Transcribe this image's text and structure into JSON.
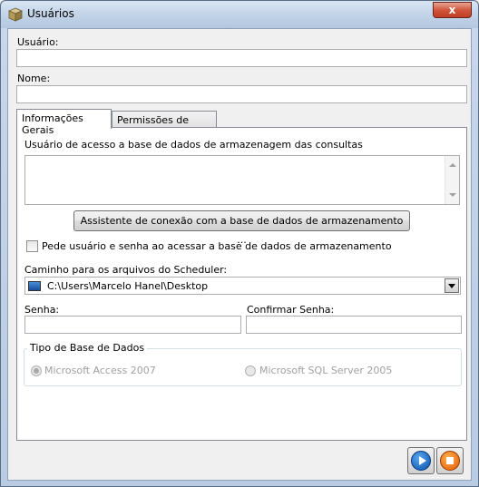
{
  "window": {
    "title": "Usuários",
    "close_label": "x"
  },
  "form": {
    "usuario_label": "Usuário:",
    "usuario_value": "",
    "nome_label": "Nome:",
    "nome_value": ""
  },
  "tabs": [
    {
      "label": "Informações Gerais",
      "active": true
    },
    {
      "label": "Permissões de Acesso",
      "active": false
    }
  ],
  "general": {
    "db_user_label": "Usuário de acesso a base de dados de armazenagem das consultas",
    "db_user_value": "",
    "wizard_button": "Assistente de conexão com a base de dados de armazenamento ...",
    "ask_credentials_label": "Pede usuário e senha ao acessar a base de dados de armazenamento",
    "ask_credentials_checked": false,
    "scheduler_path_label": "Caminho para os arquivos do Scheduler:",
    "scheduler_path_value": "C:\\Users\\Marcelo Hanel\\Desktop",
    "senha_label": "Senha:",
    "senha_value": "",
    "confirmar_label": "Confirmar Senha:",
    "confirmar_value": "",
    "db_type_legend": "Tipo de Base de Dados",
    "db_type_options": [
      {
        "label": "Microsoft Access 2007",
        "selected": true
      },
      {
        "label": "Microsoft SQL Server 2005",
        "selected": false
      }
    ]
  },
  "footer": {
    "ok_icon": "play-icon",
    "cancel_icon": "stop-icon"
  }
}
